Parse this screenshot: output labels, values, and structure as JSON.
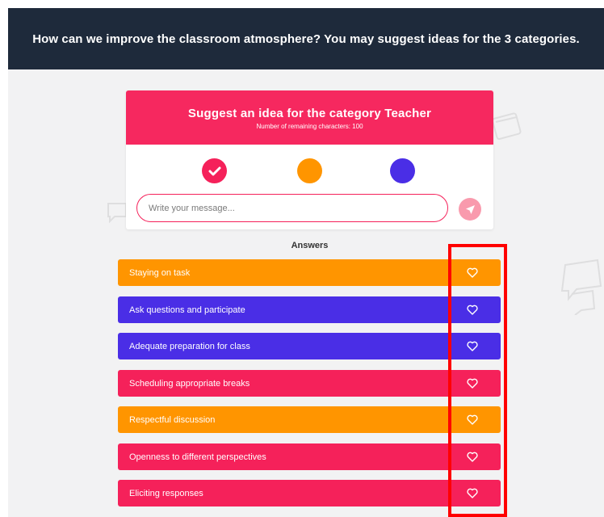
{
  "header": {
    "title": "How can we improve the classroom atmosphere? You may suggest ideas for the 3 categories."
  },
  "card": {
    "title": "Suggest an idea for the category Teacher",
    "subtitle": "Number of remaining characters: 100",
    "categories": [
      {
        "color": "#f5215a",
        "selected": true,
        "icon": "check-icon"
      },
      {
        "color": "#ff9500",
        "selected": false
      },
      {
        "color": "#4a2ee6",
        "selected": false
      }
    ],
    "input": {
      "value": "",
      "placeholder": "Write your message..."
    },
    "send_icon": "send-icon"
  },
  "answers": {
    "title": "Answers",
    "items": [
      {
        "label": "Staying on task",
        "color": "#ff9500"
      },
      {
        "label": "Ask questions and participate",
        "color": "#4a2ee6"
      },
      {
        "label": "Adequate preparation for class",
        "color": "#4a2ee6"
      },
      {
        "label": "Scheduling appropriate breaks",
        "color": "#f5215a"
      },
      {
        "label": "Respectful discussion",
        "color": "#ff9500"
      },
      {
        "label": "Openness to different perspectives",
        "color": "#f5215a"
      },
      {
        "label": "Eliciting responses",
        "color": "#f5215a"
      }
    ]
  },
  "annotation": {
    "color": "#ff0000"
  }
}
